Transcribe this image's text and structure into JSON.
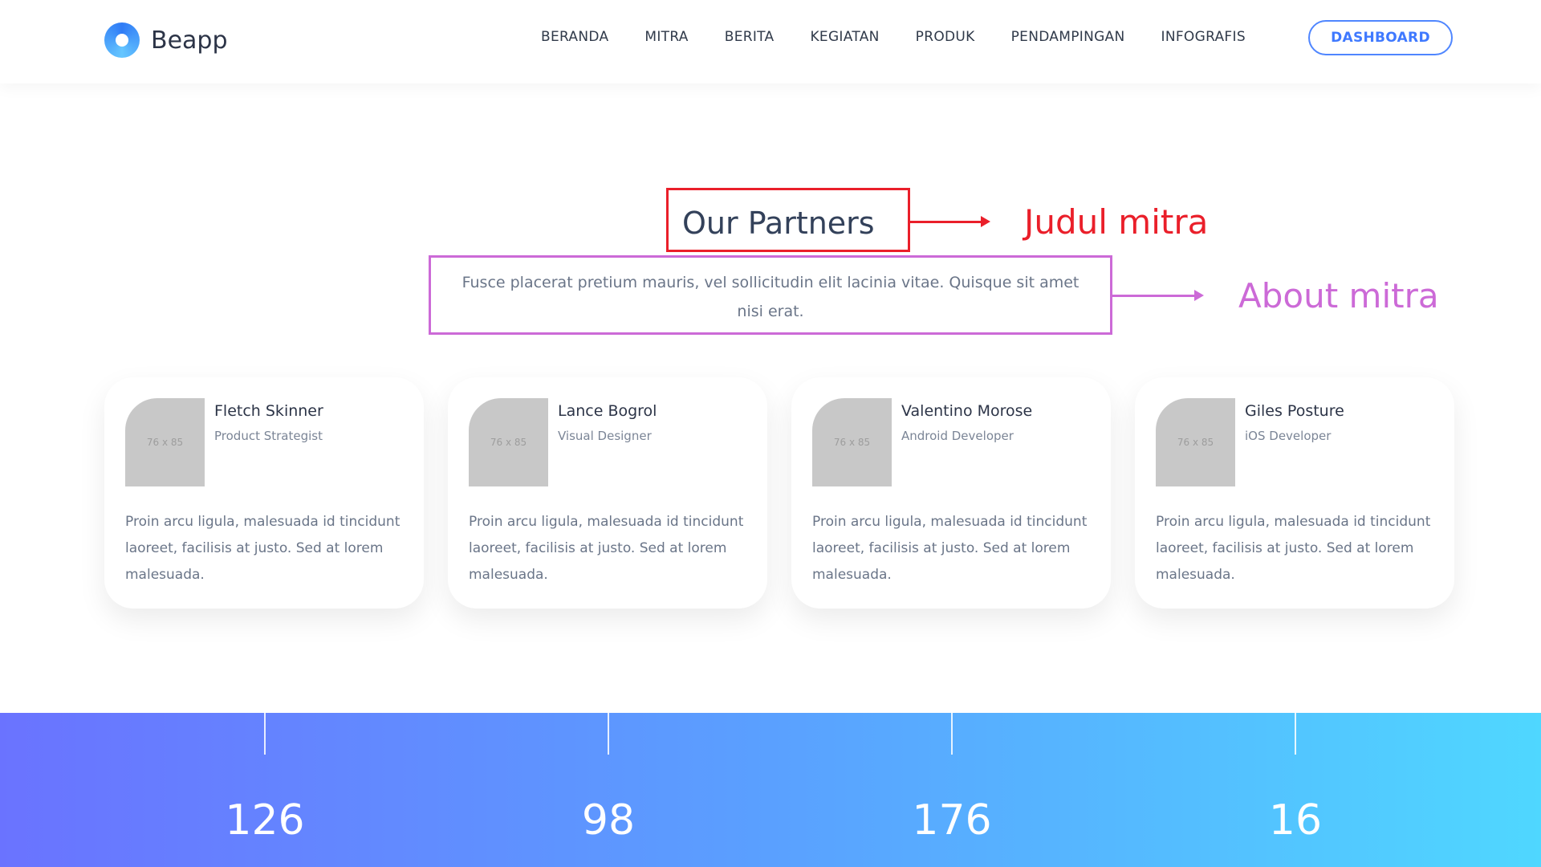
{
  "header": {
    "logo_text": "Beapp",
    "nav": [
      "BERANDA",
      "MITRA",
      "BERITA",
      "KEGIATAN",
      "PRODUK",
      "PENDAMPINGAN",
      "INFOGRAFIS"
    ],
    "dashboard_label": "DASHBOARD"
  },
  "section": {
    "title": "Our Partners",
    "about": "Fusce placerat pretium mauris, vel sollicitudin elit lacinia vitae. Quisque sit amet nisi erat."
  },
  "annotations": {
    "red_label": "Judul mitra",
    "purple_label": "About mitra",
    "red_color": "#ea1f2a",
    "purple_color": "#cc6ad7"
  },
  "cards": [
    {
      "avatar_label": "76 x 85",
      "name": "Fletch Skinner",
      "role": "Product Strategist",
      "desc": "Proin arcu ligula, malesuada id tincidunt laoreet, facilisis at justo. Sed at lorem malesuada."
    },
    {
      "avatar_label": "76 x 85",
      "name": "Lance Bogrol",
      "role": "Visual Designer",
      "desc": "Proin arcu ligula, malesuada id tincidunt laoreet, facilisis at justo. Sed at lorem malesuada."
    },
    {
      "avatar_label": "76 x 85",
      "name": "Valentino Morose",
      "role": "Android Developer",
      "desc": "Proin arcu ligula, malesuada id tincidunt laoreet, facilisis at justo. Sed at lorem malesuada."
    },
    {
      "avatar_label": "76 x 85",
      "name": "Giles Posture",
      "role": "iOS Developer",
      "desc": "Proin arcu ligula, malesuada id tincidunt laoreet, facilisis at justo. Sed at lorem malesuada."
    }
  ],
  "stats": [
    {
      "value": "126"
    },
    {
      "value": "98"
    },
    {
      "value": "176"
    },
    {
      "value": "16"
    }
  ],
  "colors": {
    "accent": "#4f86ff",
    "gradient_start": "#6a73ff",
    "gradient_end": "#4fd7ff"
  }
}
